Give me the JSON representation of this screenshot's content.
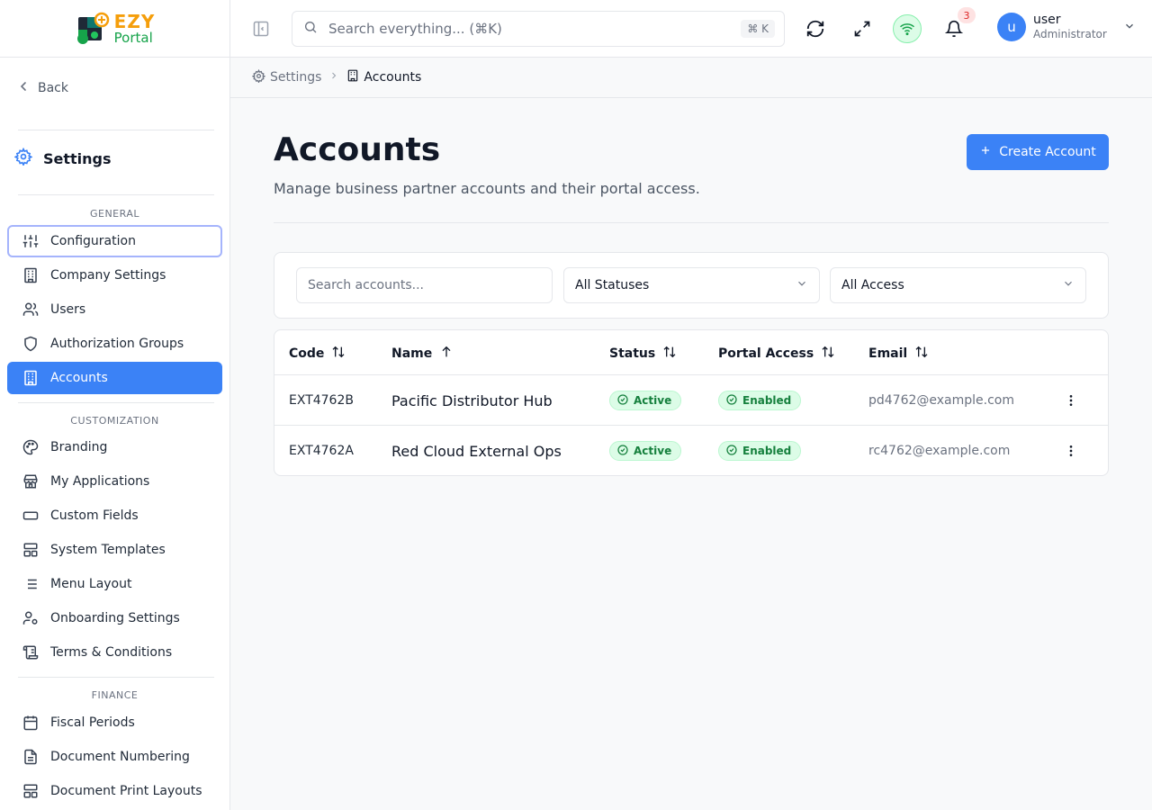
{
  "logo": {
    "word1": "EZY",
    "word2": "Portal"
  },
  "sidebar": {
    "back_label": "Back",
    "title": "Settings",
    "sections": {
      "general": "GENERAL",
      "customization": "CUSTOMIZATION",
      "finance": "FINANCE"
    },
    "items": [
      {
        "label": "Configuration",
        "icon": "sliders-icon"
      },
      {
        "label": "Company Settings",
        "icon": "building-icon"
      },
      {
        "label": "Users",
        "icon": "users-icon"
      },
      {
        "label": "Authorization Groups",
        "icon": "shield-icon"
      },
      {
        "label": "Accounts",
        "icon": "building-icon"
      },
      {
        "label": "Branding",
        "icon": "palette-icon"
      },
      {
        "label": "My Applications",
        "icon": "store-icon"
      },
      {
        "label": "Custom Fields",
        "icon": "input-field-icon"
      },
      {
        "label": "System Templates",
        "icon": "template-icon"
      },
      {
        "label": "Menu Layout",
        "icon": "list-icon"
      },
      {
        "label": "Onboarding Settings",
        "icon": "user-cog-icon"
      },
      {
        "label": "Terms & Conditions",
        "icon": "scroll-icon"
      },
      {
        "label": "Fiscal Periods",
        "icon": "calendar-icon"
      },
      {
        "label": "Document Numbering",
        "icon": "file-text-icon"
      },
      {
        "label": "Document Print Layouts",
        "icon": "layout-icon"
      }
    ]
  },
  "topbar": {
    "search_placeholder": "Search everything... (⌘K)",
    "search_shortcut": "⌘ K",
    "notification_count": "3",
    "user_initial": "u",
    "user_name": "user",
    "user_role": "Administrator"
  },
  "breadcrumb": {
    "parent": "Settings",
    "current": "Accounts"
  },
  "page": {
    "title": "Accounts",
    "subtitle": "Manage business partner accounts and their portal access.",
    "create_label": "Create Account"
  },
  "filters": {
    "search_placeholder": "Search accounts...",
    "status_value": "All Statuses",
    "access_value": "All Access"
  },
  "table": {
    "columns": [
      "Code",
      "Name",
      "Status",
      "Portal Access",
      "Email"
    ],
    "rows": [
      {
        "code": "EXT4762B",
        "name": "Pacific Distributor Hub",
        "status": "Active",
        "access": "Enabled",
        "email": "pd4762@example.com"
      },
      {
        "code": "EXT4762A",
        "name": "Red Cloud External Ops",
        "status": "Active",
        "access": "Enabled",
        "email": "rc4762@example.com"
      }
    ]
  },
  "colors": {
    "accent": "#3b82f6",
    "success_bg": "#dcfce7",
    "success_text": "#15803d",
    "logo_orange": "#f59e0b",
    "logo_green": "#16a34a"
  }
}
